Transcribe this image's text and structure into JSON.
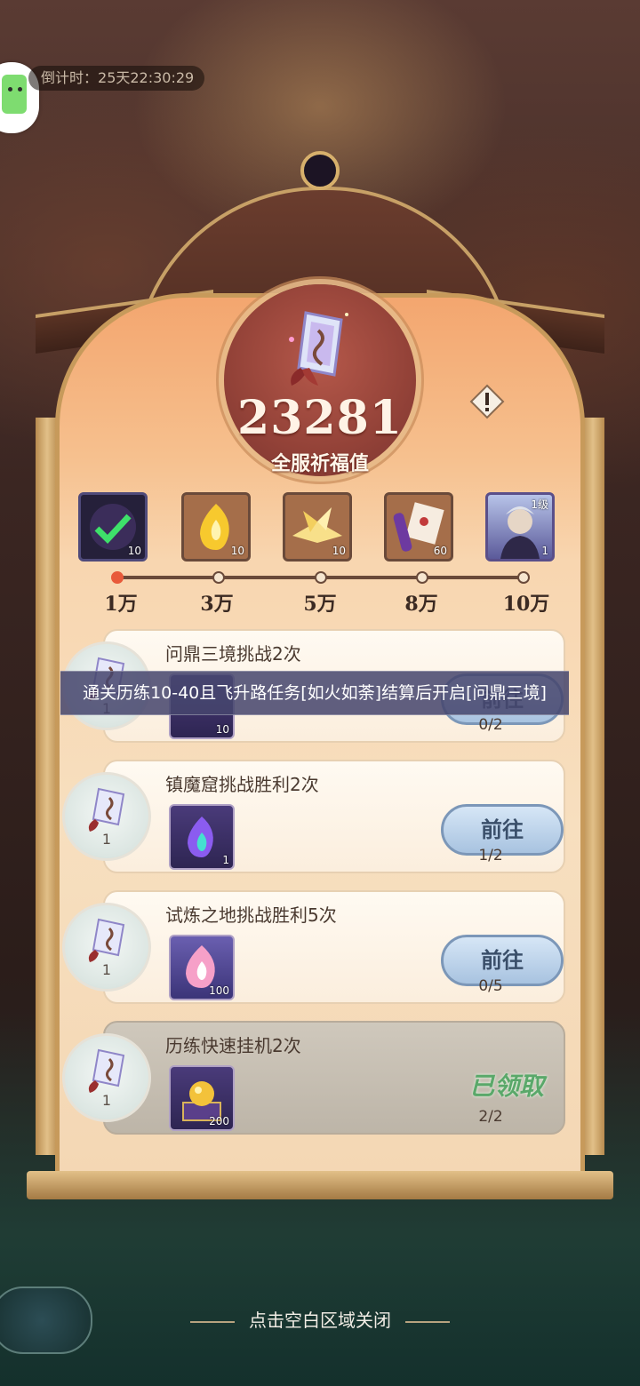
{
  "header": {
    "countdown_label": "倒计时：",
    "countdown_value": "25天22:30:29"
  },
  "blessing": {
    "value": "23281",
    "label": "全服祈福值"
  },
  "milestones": [
    {
      "label": "1万",
      "reward_count": "10",
      "reward_icon": "check-icon",
      "claimed": true
    },
    {
      "label": "3万",
      "reward_count": "10",
      "reward_icon": "golden-flame-icon",
      "claimed": false
    },
    {
      "label": "5万",
      "reward_count": "10",
      "reward_icon": "paper-crane-icon",
      "claimed": false
    },
    {
      "label": "8万",
      "reward_count": "60",
      "reward_icon": "scroll-icon",
      "claimed": false
    },
    {
      "label": "10万",
      "reward_count": "1",
      "reward_icon": "character-portrait",
      "reward_badge": "1级",
      "claimed": false
    }
  ],
  "tasks": [
    {
      "title": "问鼎三境挑战2次",
      "points": "1",
      "item_count": "10",
      "progress": "0/2",
      "button": "前往",
      "status": "locked"
    },
    {
      "title": "镇魔窟挑战胜利2次",
      "points": "1",
      "item_count": "1",
      "progress": "1/2",
      "button": "前往",
      "status": "open"
    },
    {
      "title": "试炼之地挑战胜利5次",
      "points": "1",
      "item_count": "100",
      "progress": "0/5",
      "button": "前往",
      "status": "open"
    },
    {
      "title": "历练快速挂机2次",
      "points": "1",
      "item_count": "200",
      "progress": "2/2",
      "button": "已领取",
      "status": "claimed"
    }
  ],
  "toast": "通关历练10-40且飞升路任务[如火如荼]结算后开启[问鼎三境]",
  "footer": {
    "close_hint": "点击空白区域关闭"
  },
  "colors": {
    "accent_red": "#e85a3a",
    "button_blue": "#a8c3e0",
    "claimed_green": "#5aa86a"
  }
}
